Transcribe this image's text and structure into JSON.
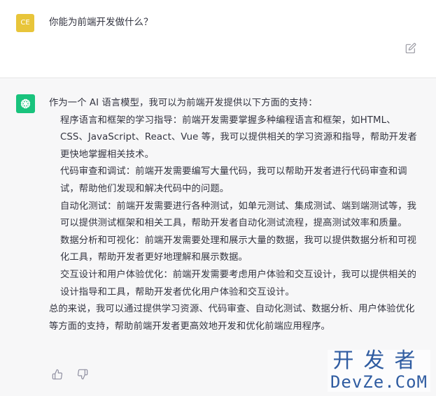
{
  "user": {
    "avatar_initials": "CE",
    "message": "你能为前端开发做什么？"
  },
  "assistant": {
    "intro": "作为一个 AI 语言模型，我可以为前端开发提供以下方面的支持：",
    "items": [
      "程序语言和框架的学习指导：前端开发需要掌握多种编程语言和框架，如HTML、CSS、JavaScript、React、Vue 等，我可以提供相关的学习资源和指导，帮助开发者更快地掌握相关技术。",
      "代码审查和调试：前端开发需要编写大量代码，我可以帮助开发者进行代码审查和调试，帮助他们发现和解决代码中的问题。",
      "自动化测试：前端开发需要进行各种测试，如单元测试、集成测试、端到端测试等，我可以提供测试框架和相关工具，帮助开发者自动化测试流程，提高测试效率和质量。",
      "数据分析和可视化：前端开发需要处理和展示大量的数据，我可以提供数据分析和可视化工具，帮助开发者更好地理解和展示数据。",
      "交互设计和用户体验优化：前端开发需要考虑用户体验和交互设计，我可以提供相关的设计指导和工具，帮助开发者优化用户体验和交互设计。"
    ],
    "summary": "总的来说，我可以通过提供学习资源、代码审查、自动化测试、数据分析、用户体验优化等方面的支持，帮助前端开发者更高效地开发和优化前端应用程序。"
  },
  "watermark": {
    "cn": "开发者",
    "en": "DevZe.CoM"
  },
  "colors": {
    "user_avatar": "#e8c53a",
    "bot_avatar": "#19c37d",
    "bot_background": "#f7f7f8",
    "text": "#343541",
    "watermark": "#1f4f9a"
  }
}
